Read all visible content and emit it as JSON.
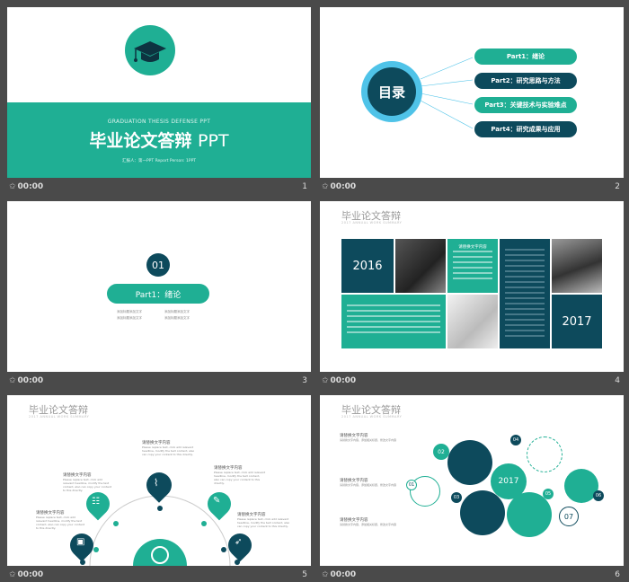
{
  "slides": [
    {
      "number": "1",
      "time": "00:00",
      "eyebrow": "GRADUATION THESIS DEFENSE PPT",
      "title": "毕业论文答辩",
      "title_suffix": "PPT",
      "reporter": "汇报人：第一PPT    Report Person: 1PPT",
      "icon": "graduation-cap-icon"
    },
    {
      "number": "2",
      "time": "00:00",
      "center_label": "目录",
      "parts": [
        "Part1：绪论",
        "Part2：研究思路与方法",
        "Part3：关键技术与实验难点",
        "Part4：研究成果与应用"
      ]
    },
    {
      "number": "3",
      "time": "00:00",
      "badge": "01",
      "pill": "Part1：绪论",
      "bullets": [
        "添加标题添加文字",
        "添加标题添加文字",
        "添加标题添加文字",
        "添加标题添加文字"
      ]
    },
    {
      "number": "4",
      "time": "00:00",
      "title": "毕业论文答辩",
      "subtitle": "2017 ANNUAL WORK SUMMARY",
      "year_a": "2016",
      "year_b": "2017",
      "box_heading": "请替换文字内容",
      "body": "添加标题文字，添加标题文字"
    },
    {
      "number": "5",
      "time": "00:00",
      "title": "毕业论文答辩",
      "subtitle": "2017 ANNUAL WORK SUMMARY",
      "item_heading": "请替换文字内容",
      "item_body": "Please replace text, click add relevant headline, modify the text content, also can copy your content to this directly.",
      "icons": [
        "team-icon",
        "paperclip-icon",
        "wrench-icon",
        "rocket-icon",
        "bus-icon",
        "globe-icon"
      ]
    },
    {
      "number": "6",
      "time": "00:00",
      "title": "毕业论文答辩",
      "subtitle": "2017 ANNUAL WORK SUMMARY",
      "year": "2017",
      "labels": [
        "01",
        "02",
        "03",
        "04",
        "05",
        "06",
        "07"
      ],
      "heading": "请替换文字内容",
      "body": "请替换文字内容，添加相关标题，修改文字内容"
    }
  ],
  "colors": {
    "teal": "#1faf94",
    "navy": "#0d4a5c",
    "cyan": "#4fc3e8",
    "bg": "#4a4a4a"
  }
}
